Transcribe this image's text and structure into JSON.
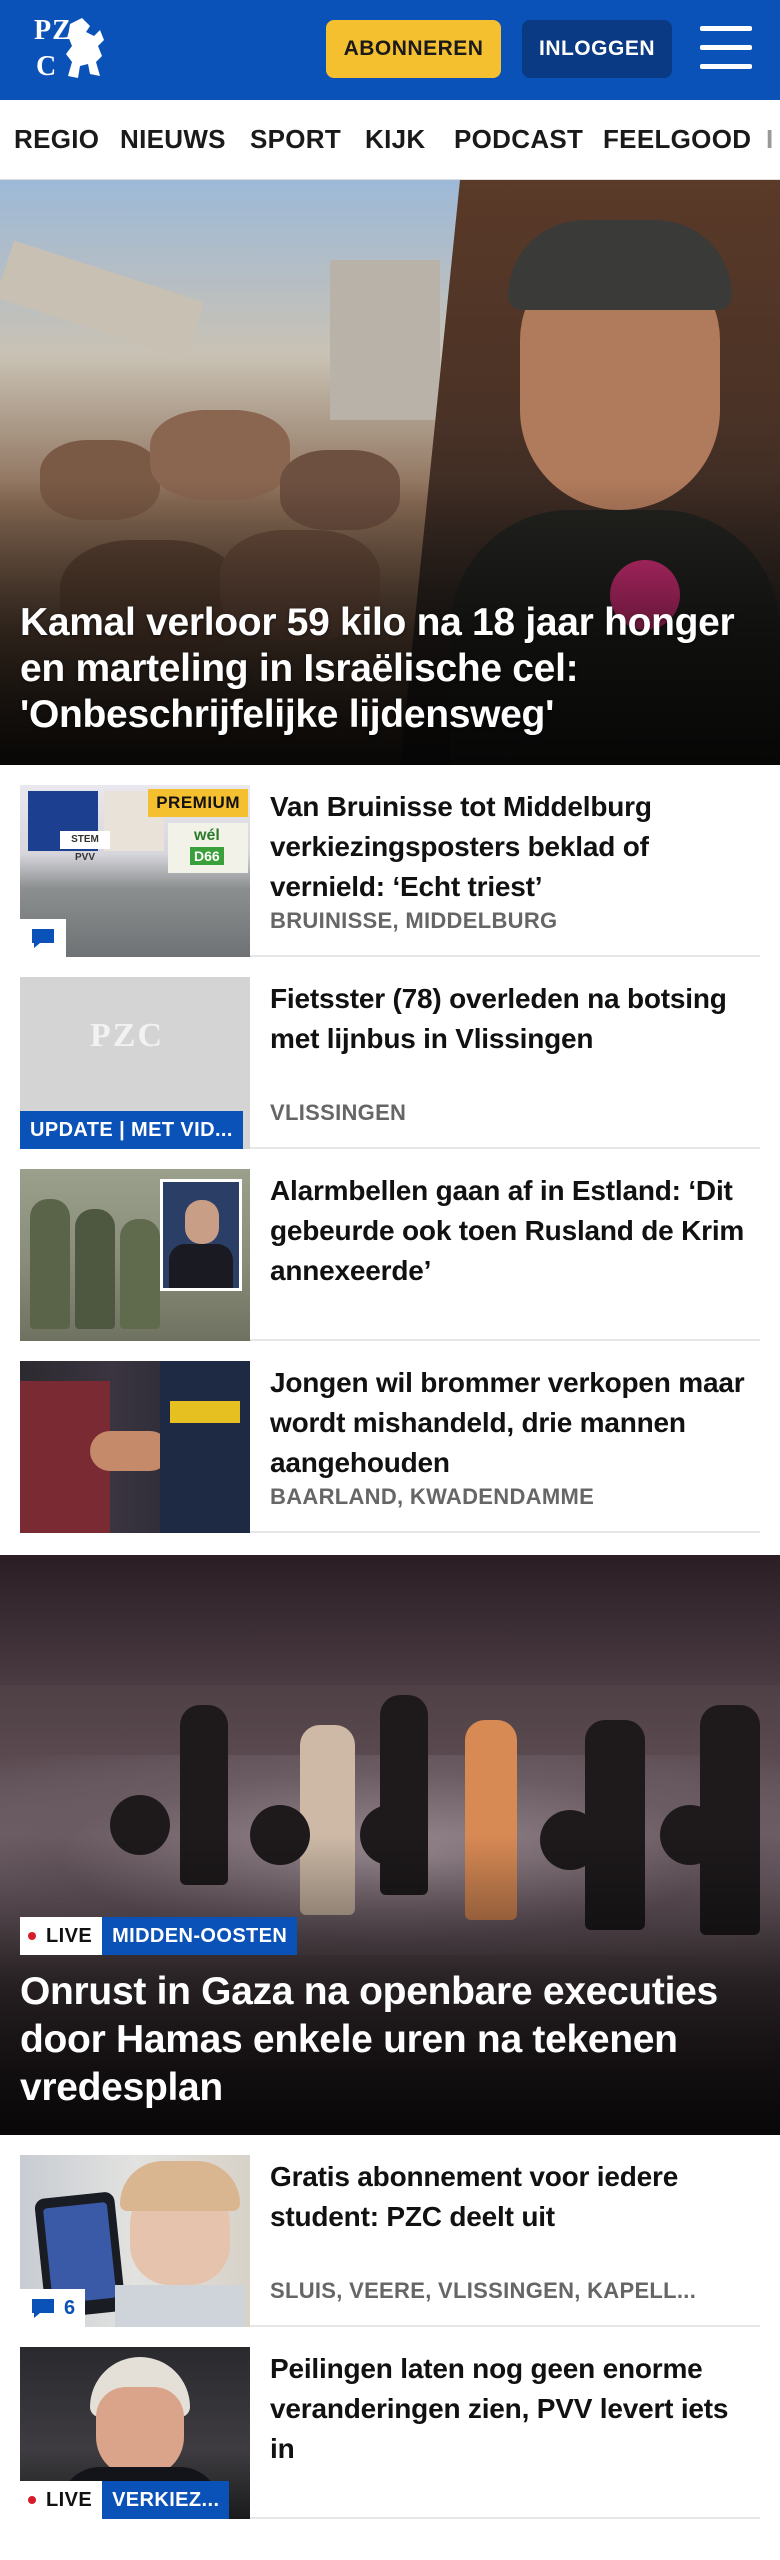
{
  "header": {
    "logo_line1": "PZ",
    "logo_line2": "C",
    "subscribe_label": "ABONNEREN",
    "login_label": "INLOGGEN",
    "brand_color": "#0b52b8",
    "accent_color": "#f5c02f"
  },
  "nav": {
    "items": [
      "REGIO",
      "NIEUWS",
      "SPORT",
      "KIJK",
      "PODCAST",
      "FEELGOOD",
      "I"
    ]
  },
  "hero": {
    "title": "Kamal verloor 59 kilo na 18 jaar honger en marteling in Israëlische cel: 'Onbeschrijfelijke lijdensweg'"
  },
  "articles": [
    {
      "title": "Van Bruinisse tot Middelburg verkiezingsposters beklad of vernield: ‘Echt triest’",
      "location": "BRUINISSE, MIDDELBURG",
      "badge": "PREMIUM",
      "thumb_text_1": "wél",
      "thumb_text_2": "D66",
      "thumb_text_3": "STEM PVV"
    },
    {
      "title": "Fietsster (78) overleden na botsing met lijnbus in Vlissingen",
      "location": "VLISSINGEN",
      "label": "UPDATE | MET VID...",
      "placeholder_logo": "PZC"
    },
    {
      "title": "Alarmbellen gaan af in Estland: ‘Dit gebeurde ook toen Rusland de Krim annexeerde’",
      "location": ""
    },
    {
      "title": "Jongen wil brommer verkopen maar wordt mishandeld, drie mannen aangehouden",
      "location": "BAARLAND, KWADENDAMME"
    }
  ],
  "hero2": {
    "live_label": "LIVE",
    "category": "MIDDEN-OOSTEN",
    "title": "Onrust in Gaza na openbare executies door Hamas enkele uren na tekenen vredesplan"
  },
  "articles2": [
    {
      "title": "Gratis abonnement voor iedere student: PZC deelt uit",
      "location": "SLUIS, VEERE, VLISSINGEN, KAPELL...",
      "comment_count": "6"
    },
    {
      "title": "Peilingen laten nog geen enorme veranderingen zien, PVV levert iets in",
      "live_label": "LIVE",
      "category": "VERKIEZ..."
    }
  ]
}
